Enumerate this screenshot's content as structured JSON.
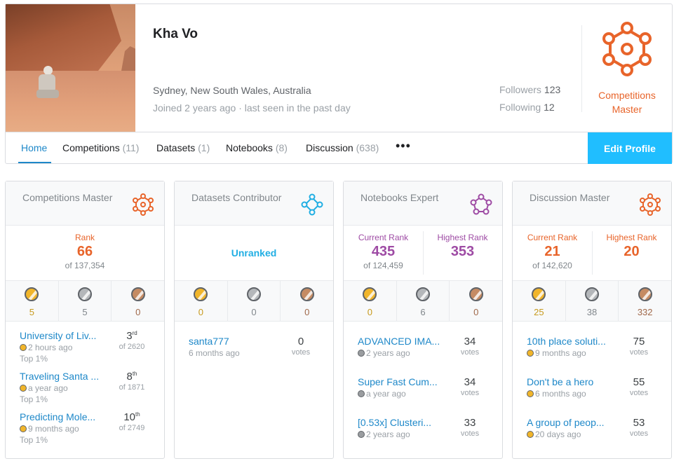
{
  "profile": {
    "name": "Kha Vo",
    "location": "Sydney, New South Wales, Australia",
    "joined": "Joined 2 years ago · last seen in the past day",
    "followers_label": "Followers",
    "followers": "123",
    "following_label": "Following",
    "following": "12",
    "tier": "Competitions Master"
  },
  "tabs": [
    {
      "label": "Home",
      "count": ""
    },
    {
      "label": "Competitions",
      "count": "(11)"
    },
    {
      "label": "Datasets",
      "count": "(1)"
    },
    {
      "label": "Notebooks",
      "count": "(8)"
    },
    {
      "label": "Discussion",
      "count": "(638)"
    }
  ],
  "more_label": "•••",
  "edit_profile": "Edit Profile",
  "colors": {
    "accent": "#20beff",
    "competitions": "#e8642a",
    "datasets": "#20aee3",
    "notebooks": "#9e4ba4",
    "discussion": "#e8642a"
  },
  "cards": [
    {
      "title": "Competitions Master",
      "icon": "competitions-hex-icon",
      "rank_label": "Rank",
      "rank": "66",
      "rank_of": "of 137,354",
      "medals": {
        "gold": "5",
        "silver": "5",
        "bronze": "0"
      },
      "items": [
        {
          "title": "University of Liv...",
          "time": "2 hours ago",
          "extra": "Top 1%",
          "place": "3",
          "suffix": "rd",
          "of": "of 2620"
        },
        {
          "title": "Traveling Santa ...",
          "time": "a year ago",
          "extra": "Top 1%",
          "place": "8",
          "suffix": "th",
          "of": "of 1871"
        },
        {
          "title": "Predicting Mole...",
          "time": "9 months ago",
          "extra": "Top 1%",
          "place": "10",
          "suffix": "th",
          "of": "of 2749"
        }
      ]
    },
    {
      "title": "Datasets Contributor",
      "icon": "datasets-icon",
      "unranked": "Unranked",
      "medals": {
        "gold": "0",
        "silver": "0",
        "bronze": "0"
      },
      "items": [
        {
          "title": "santa777",
          "time": "6 months ago",
          "votes": "0",
          "votes_label": "votes"
        }
      ]
    },
    {
      "title": "Notebooks Expert",
      "icon": "notebooks-icon",
      "current_label": "Current Rank",
      "current": "435",
      "current_of": "of 124,459",
      "highest_label": "Highest Rank",
      "highest": "353",
      "medals": {
        "gold": "0",
        "silver": "6",
        "bronze": "0"
      },
      "items": [
        {
          "title": "ADVANCED IMA...",
          "time": "2 years ago",
          "votes": "34",
          "votes_label": "votes"
        },
        {
          "title": "Super Fast Cum...",
          "time": "a year ago",
          "votes": "34",
          "votes_label": "votes"
        },
        {
          "title": "[0.53x] Clusteri...",
          "time": "2 years ago",
          "votes": "33",
          "votes_label": "votes"
        }
      ]
    },
    {
      "title": "Discussion Master",
      "icon": "discussion-hex-icon",
      "current_label": "Current Rank",
      "current": "21",
      "current_of": "of 142,620",
      "highest_label": "Highest Rank",
      "highest": "20",
      "medals": {
        "gold": "25",
        "silver": "38",
        "bronze": "332"
      },
      "items": [
        {
          "title": "10th place soluti...",
          "time": "9 months ago",
          "votes": "75",
          "votes_label": "votes"
        },
        {
          "title": "Don't be a hero",
          "time": "6 months ago",
          "votes": "55",
          "votes_label": "votes"
        },
        {
          "title": "A group of peop...",
          "time": "20 days ago",
          "votes": "53",
          "votes_label": "votes"
        }
      ]
    }
  ]
}
